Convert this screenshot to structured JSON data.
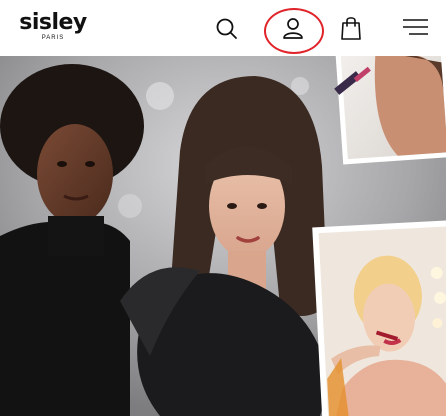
{
  "header": {
    "logo": {
      "name": "sisley",
      "tagline": "PARIS"
    },
    "icons": {
      "search": "search-icon",
      "account": "user-icon",
      "bag": "shopping-bag-icon",
      "menu": "hamburger-menu-icon"
    },
    "highlight_color": "#e0242a"
  },
  "hero": {
    "image": "hero-collage-photo"
  }
}
